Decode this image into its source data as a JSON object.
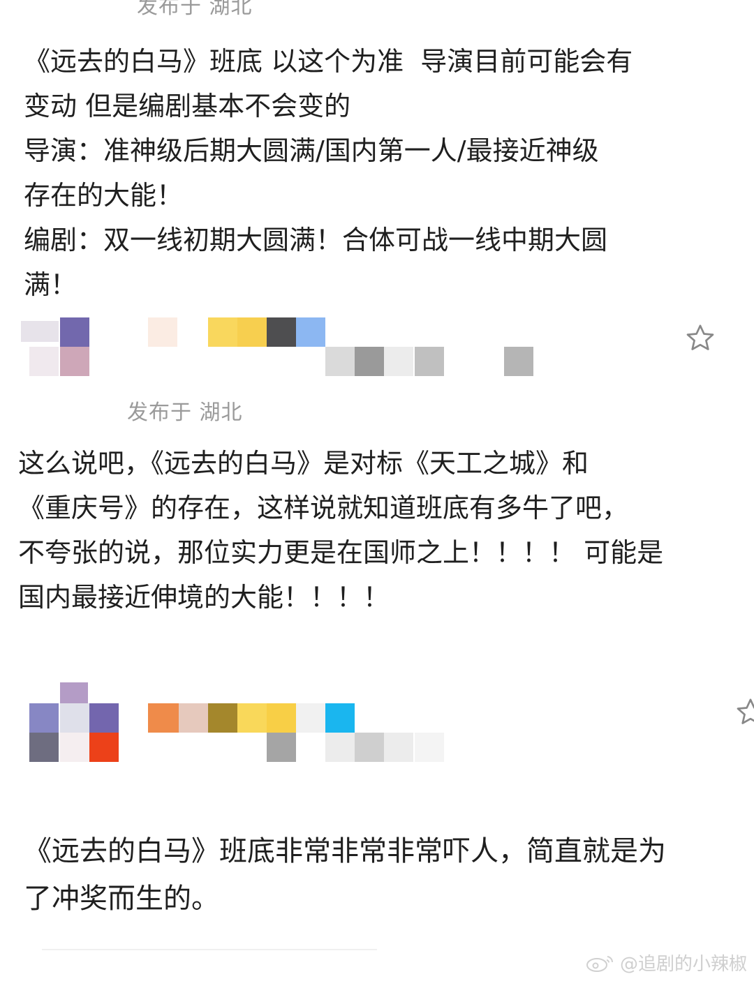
{
  "post1": {
    "top_location": "发布于 湖北",
    "text": "《远去的白马》班底 以这个为准  导演目前可能会有\n变动 但是编剧基本不会变的\n导演：准神级后期大圆满/国内第一人/最接近神级\n存在的大能！\n编剧：双一线初期大圆满！合体可战一线中期大圆\n满！"
  },
  "post2": {
    "location": "发布于 湖北",
    "text": "这么说吧，《远去的白马》是对标《天工之城》和\n《重庆号》的存在，这样说就知道班底有多牛了吧，\n不夸张的说，那位实力更是在国师之上！！！！ 可能是\n国内最接近伸境的大能！！！！"
  },
  "post3": {
    "text": "《远去的白马》班底非常非常非常吓人，简直就是为\n了冲奖而生的。"
  },
  "icons": {
    "favorite": "star-outline-icon",
    "weibo": "weibo-logo-icon"
  },
  "watermark": {
    "text": "@追剧的小辣椒"
  },
  "colors": {
    "meta": "#9a9a9a",
    "text": "#1f1f1f"
  }
}
